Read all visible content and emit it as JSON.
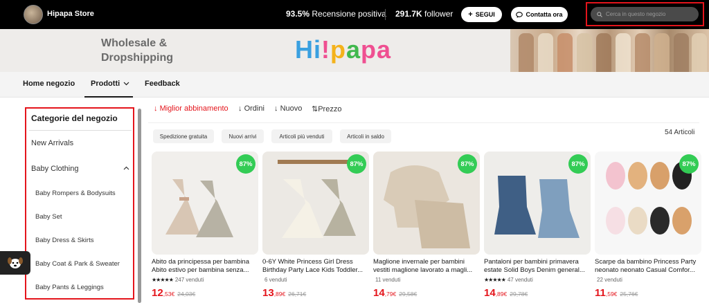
{
  "header": {
    "store_name": "Hipapa Store",
    "rating_value": "93.5%",
    "rating_label": "Recensione positiva",
    "followers_value": "291.7K",
    "followers_label": "follower",
    "follow_label": "SEGUI",
    "contact_label": "Contatta ora",
    "search_placeholder": "Cerca in questo negozio"
  },
  "banner": {
    "line1": "Wholesale &",
    "line2": "Dropshipping",
    "logo": [
      "Hi",
      "!",
      "p",
      "a",
      "pa"
    ]
  },
  "nav": {
    "home": "Home negozio",
    "products": "Prodotti",
    "feedback": "Feedback"
  },
  "sidebar": {
    "title": "Categorie del negozio",
    "items": [
      "New Arrivals",
      "Baby Clothing"
    ],
    "subitems": [
      "Baby Rompers & Bodysuits",
      "Baby Set",
      "Baby Dress & Skirts",
      "Baby Coat & Park & Sweater",
      "Baby Pants & Leggings"
    ]
  },
  "sort": {
    "best": "Miglior abbinamento",
    "orders": "Ordini",
    "new": "Nuovo",
    "price": "Prezzo"
  },
  "filters": [
    "Spedizione gratuita",
    "Nuovi arrivi",
    "Articoli più venduti",
    "Articoli in saldo"
  ],
  "count": "54 Articoli",
  "products": [
    {
      "badge": "87%",
      "title": "Abito da principessa per bambina Abito estivo per bambina senza...",
      "sold": "247 venduti",
      "price_int": "12",
      "price_dec": ",53€",
      "old": "24,03€",
      "stars": "★★★★★"
    },
    {
      "badge": "87%",
      "title": "0-6Y White Princess Girl Dress Birthday Party Lace Kids Toddler...",
      "sold": "6 venduti",
      "price_int": "13",
      "price_dec": ",89€",
      "old": "26,71€",
      "stars": ""
    },
    {
      "badge": "87%",
      "title": "Maglione invernale per bambini vestiti maglione lavorato a magli...",
      "sold": "11 venduti",
      "price_int": "14",
      "price_dec": ",79€",
      "old": "29,58€",
      "stars": ""
    },
    {
      "badge": "87%",
      "title": "Pantaloni per bambini primavera estate Solid Boys Denim general...",
      "sold": "47 venduti",
      "price_int": "14",
      "price_dec": ",89€",
      "old": "29,78€",
      "stars": "★★★★★"
    },
    {
      "badge": "87%",
      "title": "Scarpe da bambino Princess Party neonato neonato Casual Comfor...",
      "sold": "22 venduti",
      "price_int": "11",
      "price_dec": ",59€",
      "old": "25,76€",
      "stars": ""
    }
  ],
  "colors": {
    "accent": "#e4141b",
    "badge": "#33cc55"
  }
}
